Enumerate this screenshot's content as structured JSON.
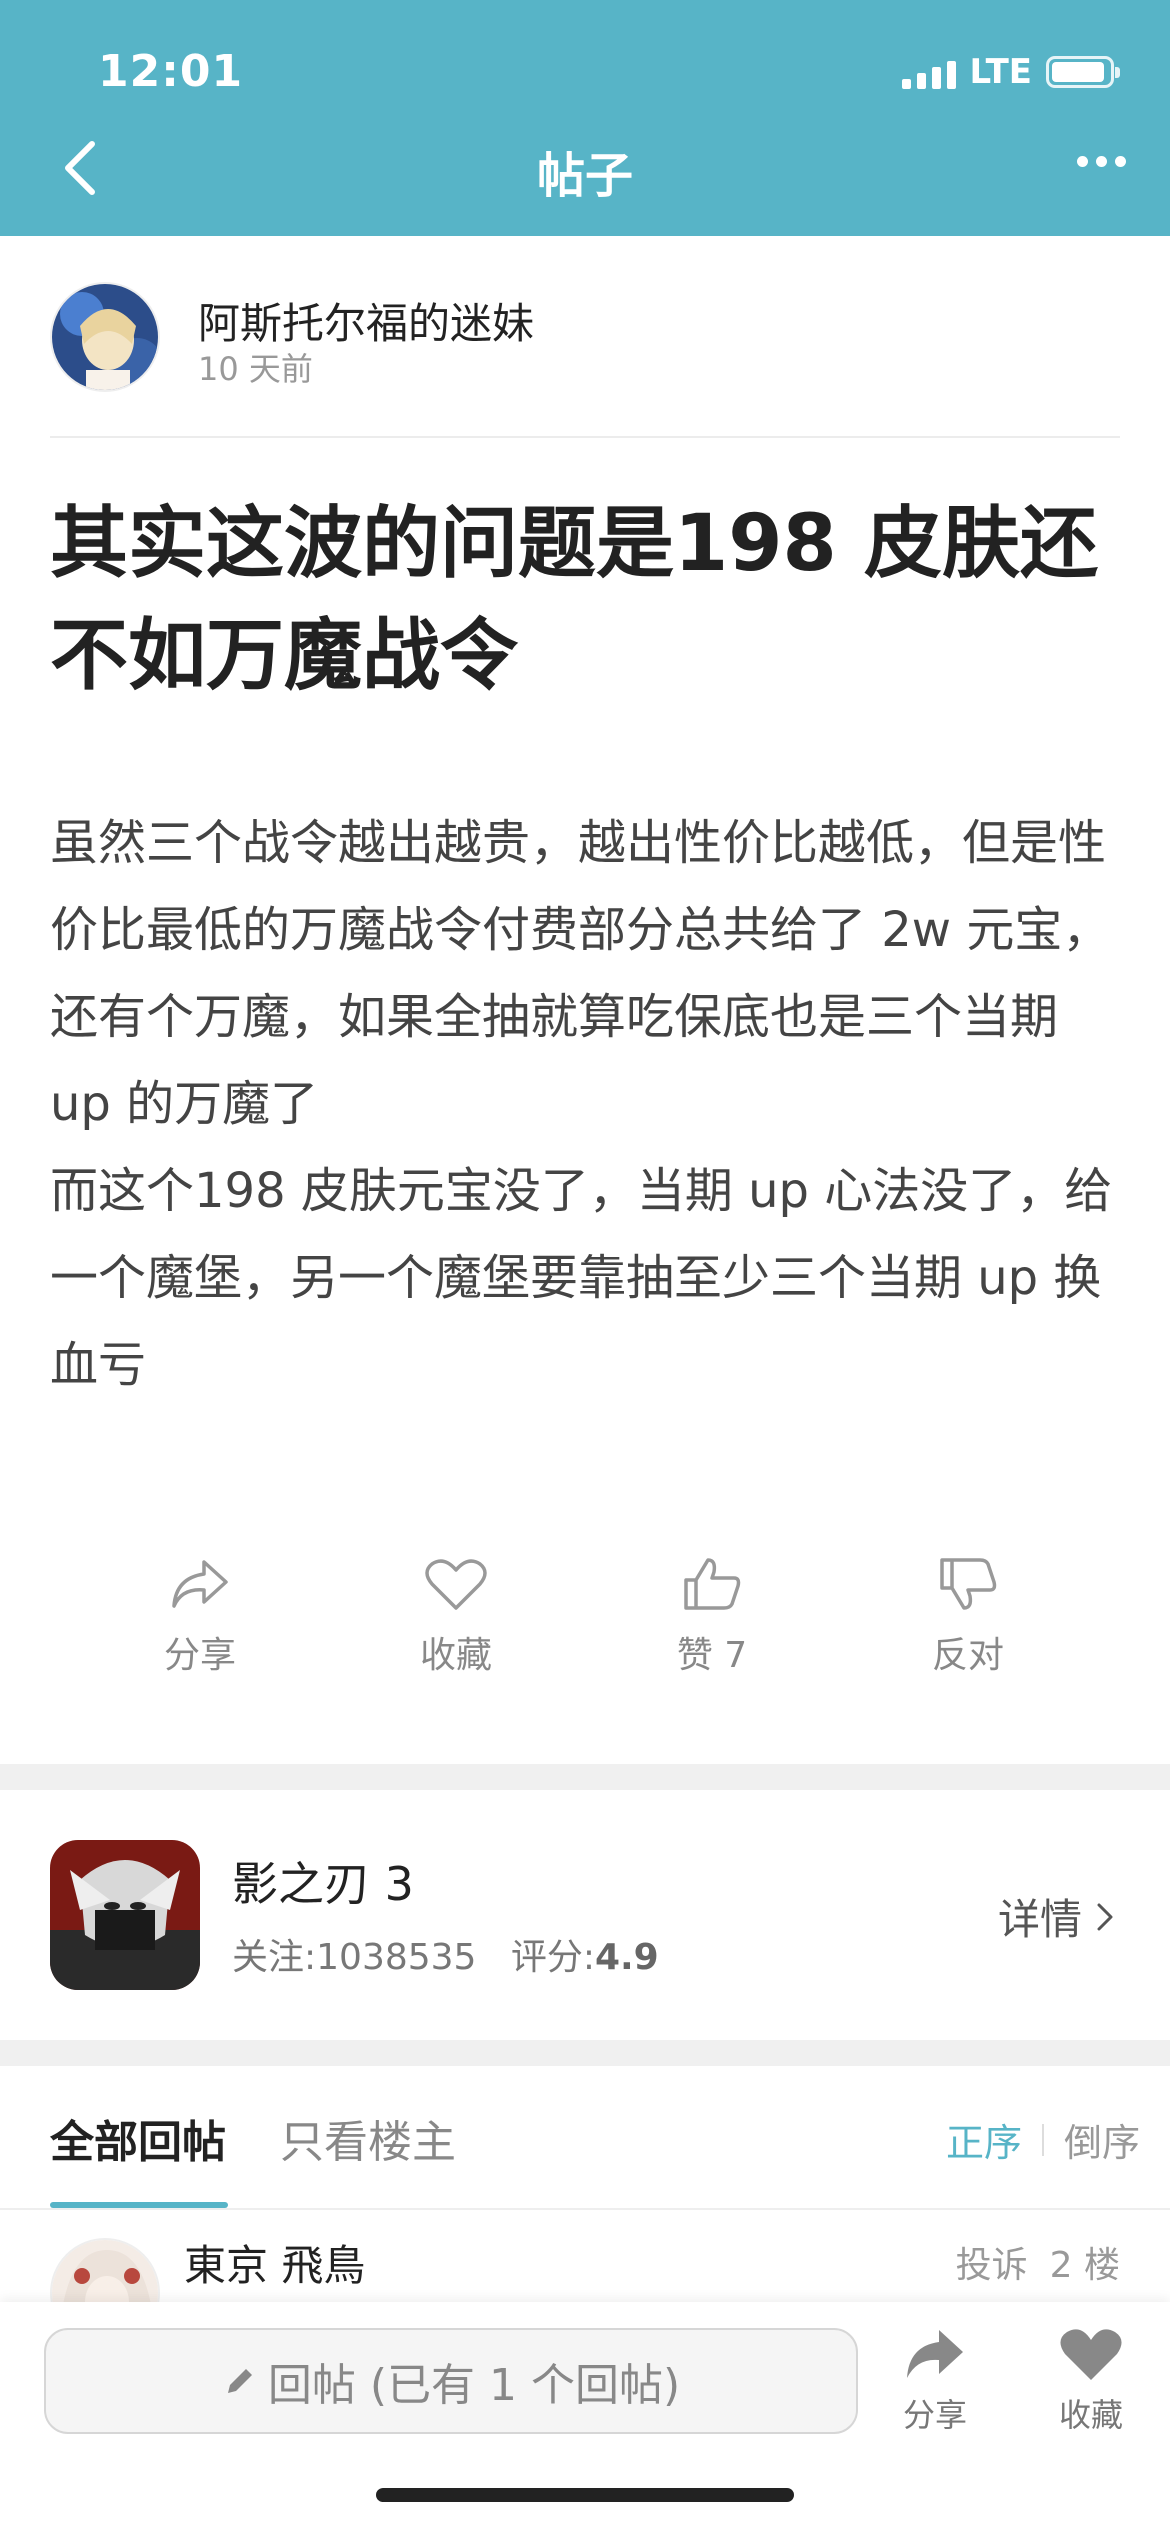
{
  "status_bar": {
    "time": "12:01",
    "network": "LTE",
    "battery_level": 0.92
  },
  "nav": {
    "title": "帖子"
  },
  "author": {
    "name": "阿斯托尔福的迷妹",
    "time": "10 天前"
  },
  "post": {
    "title": "其实这波的问题是198 皮肤还不如万魔战令",
    "body": "虽然三个战令越出越贵，越出性价比越低，但是性价比最低的万魔战令付费部分总共给了 2w 元宝，还有个万魔，如果全抽就算吃保底也是三个当期 up 的万魔了\n而这个198 皮肤元宝没了，当期 up 心法没了，给一个魔堡，另一个魔堡要靠抽至少三个当期 up 换\n血亏"
  },
  "actions": {
    "share": "分享",
    "favorite": "收藏",
    "like": "赞 7",
    "oppose": "反对"
  },
  "game": {
    "name": "影之刃 3",
    "followers_label": "关注:1038535",
    "rating_label": "评分:",
    "rating": "4.9",
    "detail_label": "详情"
  },
  "tabs": {
    "all": "全部回帖",
    "owner_only": "只看楼主",
    "sort_asc": "正序",
    "sort_desc": "倒序"
  },
  "reply": {
    "name": "東京 飛鳥",
    "report": "投诉",
    "floor": "2 楼"
  },
  "bottom_bar": {
    "input_placeholder": "回帖 (已有 1 个回帖)",
    "share": "分享",
    "favorite": "收藏"
  },
  "colors": {
    "accent": "#57b4c7"
  }
}
